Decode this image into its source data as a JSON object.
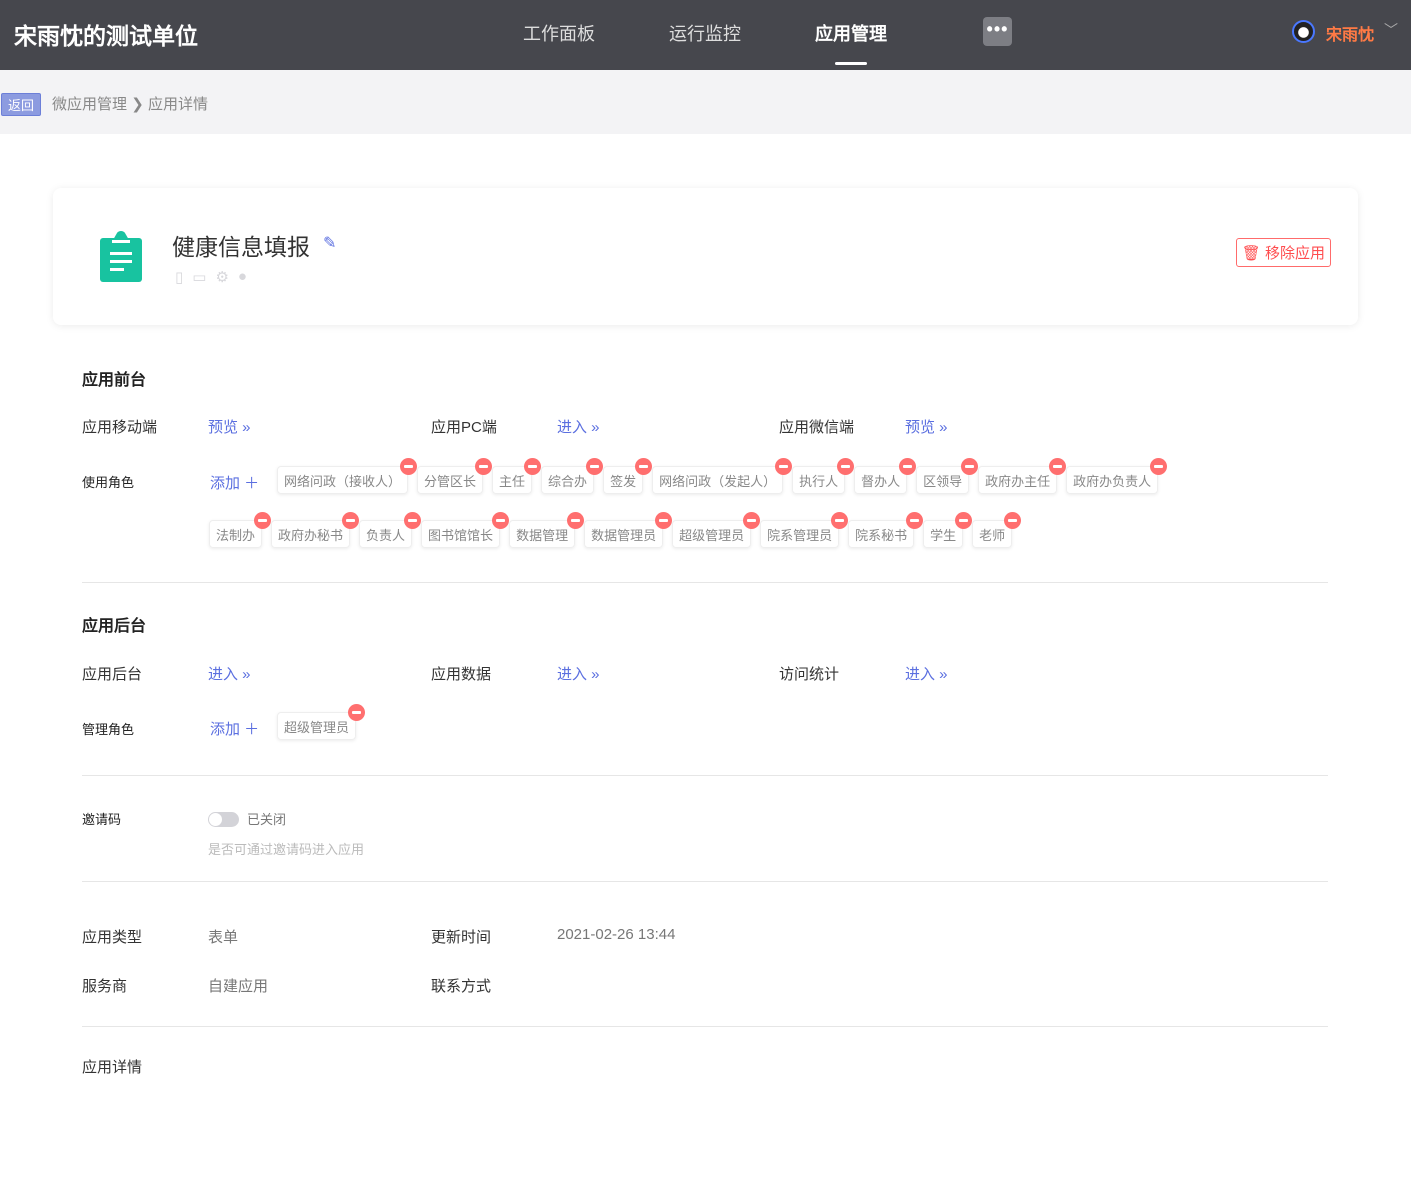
{
  "header": {
    "brand": "宋雨忱的测试单位",
    "nav": [
      "工作面板",
      "运行监控",
      "应用管理"
    ],
    "active_nav": "应用管理",
    "more": "•••",
    "user": "宋雨忱"
  },
  "breadcrumb": {
    "back": "返回",
    "items": [
      "微应用管理",
      "应用详情"
    ],
    "sep": "❯"
  },
  "app": {
    "name": "健康信息填报",
    "remove": "移除应用"
  },
  "front": {
    "title": "应用前台",
    "mobile_label": "应用移动端",
    "mobile_link": "预览 »",
    "pc_label": "应用PC端",
    "pc_link": "进入 »",
    "wechat_label": "应用微信端",
    "wechat_link": "预览 »",
    "roles_label": "使用角色",
    "add": "添加 ＋",
    "roles_row1": [
      "网络问政（接收人）",
      "分管区长",
      "主任",
      "综合办",
      "签发",
      "网络问政（发起人）",
      "执行人",
      "督办人",
      "区领导",
      "政府办主任",
      "政府办负责人"
    ],
    "roles_row2": [
      "法制办",
      "政府办秘书",
      "负责人",
      "图书馆馆长",
      "数据管理",
      "数据管理员",
      "超级管理员",
      "院系管理员",
      "院系秘书",
      "学生",
      "老师"
    ]
  },
  "back": {
    "title": "应用后台",
    "admin_label": "应用后台",
    "admin_link": "进入 »",
    "data_label": "应用数据",
    "data_link": "进入 »",
    "stats_label": "访问统计",
    "stats_link": "进入 »",
    "roles_label": "管理角色",
    "add": "添加 ＋",
    "roles": [
      "超级管理员"
    ]
  },
  "invite": {
    "label": "邀请码",
    "state": "已关闭",
    "hint": "是否可通过邀请码进入应用",
    "enabled": false
  },
  "info": {
    "type_label": "应用类型",
    "type": "表单",
    "update_label": "更新时间",
    "update": "2021-02-26 13:44",
    "provider_label": "服务商",
    "provider": "自建应用",
    "contact_label": "联系方式"
  },
  "detail": {
    "label": "应用详情"
  }
}
